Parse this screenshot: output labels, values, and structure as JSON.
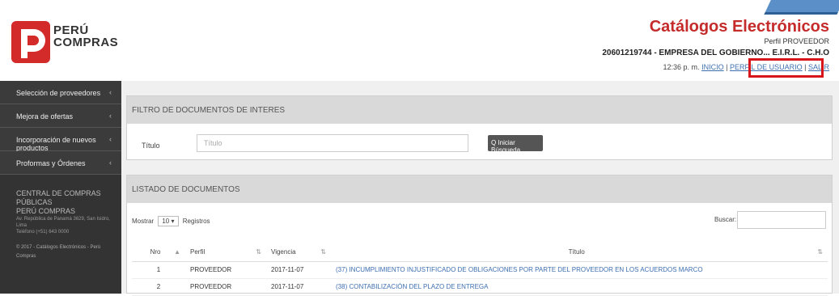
{
  "brand": {
    "line1": "PERÚ",
    "line2": "COMPRAS"
  },
  "header": {
    "app_title": "Catálogos Electrónicos",
    "perfil": "Perfil PROVEEDOR",
    "empresa": "20601219744 - EMPRESA DEL GOBIERNO... E.I.R.L. - C.H.O",
    "time": "12:36 p. m.",
    "inicio": "INICIO",
    "perfil_usuario": "PERFIL DE USUARIO",
    "salir": "SALIR"
  },
  "sidebar": {
    "items": [
      {
        "label": "Selección de proveedores"
      },
      {
        "label": "Mejora de ofertas"
      },
      {
        "label": "Incorporación de nuevos productos"
      },
      {
        "label": "Proformas y Órdenes"
      }
    ],
    "info_title": "CENTRAL DE COMPRAS PÚBLICAS",
    "info_subtitle": "PERÚ COMPRAS",
    "info_address": "Av. República de Panamá 3629, San Isidro, Lima",
    "info_phone": "Teléfono (+51) 643 0000",
    "copyright": "© 2017 - Catálogos Electrónicos - Perú Compras"
  },
  "filtro": {
    "heading": "FILTRO DE DOCUMENTOS DE INTERES",
    "titulo_label": "Título",
    "titulo_placeholder": "Título",
    "search_button": "Q Iniciar Búsqueda"
  },
  "listado": {
    "heading": "LISTADO DE DOCUMENTOS",
    "mostrar": "Mostrar",
    "page_size": "10",
    "registros": "Registros",
    "buscar": "Buscar:",
    "columns": [
      "Nro",
      "Perfil",
      "Vigencia",
      "Título"
    ],
    "rows": [
      {
        "nro": "1",
        "perfil": "PROVEEDOR",
        "vigencia": "2017-11-07",
        "titulo": "(37) INCUMPLIMIENTO INJUSTIFICADO DE OBLIGACIONES POR PARTE DEL PROVEEDOR EN LOS ACUERDOS MARCO"
      },
      {
        "nro": "2",
        "perfil": "PROVEEDOR",
        "vigencia": "2017-11-07",
        "titulo": "(38) CONTABILIZACIÓN DEL PLAZO DE ENTREGA"
      }
    ]
  },
  "colors": {
    "accent_red": "#c52b2b",
    "highlight_box": "#d6161b",
    "sidebar": "#333333",
    "link": "#3d6fb0"
  }
}
